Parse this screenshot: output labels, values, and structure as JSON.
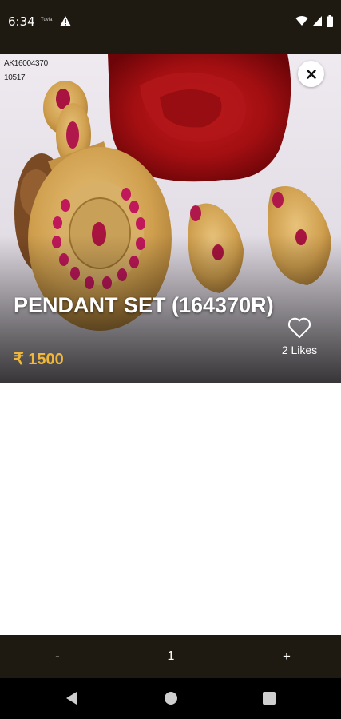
{
  "status_bar": {
    "time": "6:34",
    "mini_label": "Tuvia"
  },
  "product": {
    "sku_line1": "AK16004370",
    "sku_line2": "10517",
    "title": "PENDANT SET (164370R)",
    "price": "₹ 1500",
    "likes": "2 Likes"
  },
  "quantity": {
    "minus": "-",
    "value": "1",
    "plus": "+"
  },
  "colors": {
    "dark_bar": "#1e1a12",
    "price": "#f0b73a"
  },
  "icons": [
    "alert-icon",
    "wifi-icon",
    "signal-icon",
    "battery-icon",
    "close-icon",
    "heart-icon",
    "back-icon",
    "home-icon",
    "recents-icon"
  ]
}
